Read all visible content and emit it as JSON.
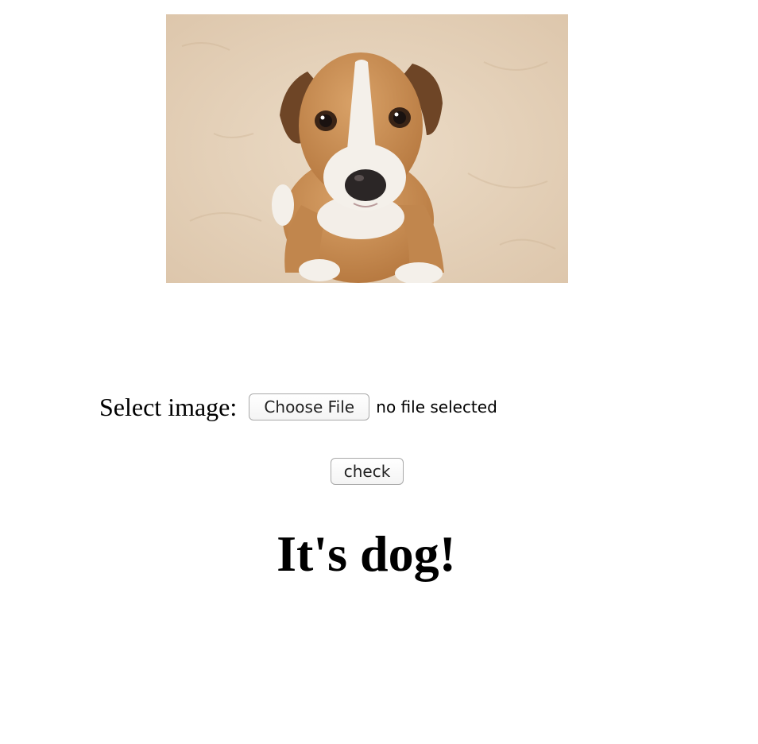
{
  "photo": {
    "subject": "puppy sitting on sand",
    "colors": {
      "sand": "#e6d3bd",
      "fur_brown": "#c58a4f",
      "fur_white": "#f5f1ec",
      "nose": "#2b2626"
    }
  },
  "form": {
    "select_label": "Select image:",
    "file_button_label": "Choose File",
    "file_status": "no file selected",
    "check_button_label": "check"
  },
  "result": {
    "text": "It's dog!"
  }
}
